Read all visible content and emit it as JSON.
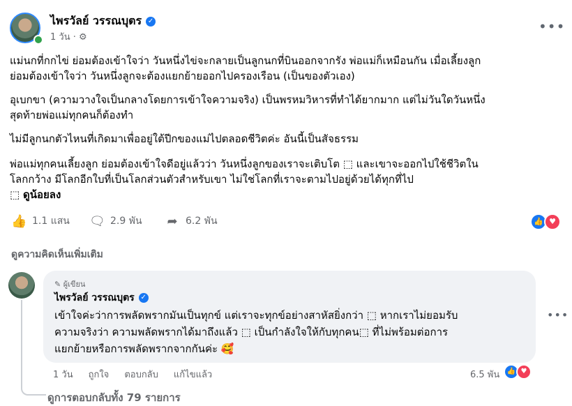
{
  "post": {
    "author": "ไพรวัลย์ วรรณบุตร",
    "time": "1 วัน",
    "paragraphs": [
      [
        "แม่นกที่กกไข่ ย่อมต้องเข้าใจว่า วันหนึ่งไข่จะกลายเป็นลูกนกที่บินออกจากรัง พ่อแม่ก็เหมือนกัน เมื่อเลี้ยงลูก",
        "ย่อมต้องเข้าใจว่า วันหนึ่งลูกจะต้องแยกย้ายออกไปครองเรือน (เป็นของตัวเอง)"
      ],
      [
        "อุเบกขา (ความวางใจเป็นกลางโดยการเข้าใจความจริง) เป็นพรหมวิหารที่ทำได้ยากมาก แต่ไม่วันใดวันหนึ่ง",
        "สุดท้ายพ่อแม่ทุกคนก็ต้องทำ"
      ],
      [
        "ไม่มีลูกนกตัวไหนที่เกิดมาเพื่ออยู่ใต้ปีกของแม่ไปตลอดชีวิตค่ะ อันนี้เป็นสัจธรรม"
      ],
      [
        "พ่อแม่ทุกคนเลี้ยงลูก ย่อมต้องเข้าใจดีอยู่แล้วว่า วันหนึ่งลูกของเราจะเติบโต ⬚ และเขาจะออกไปใช้ชีวิตใน",
        "โลกกว้าง มีโลกอีกใบที่เป็นโลกส่วนตัวสำหรับเขา ไม่ใช่โลกที่เราจะตามไปอยู่ด้วยได้ทุกที่ไป"
      ]
    ],
    "last_line_glyph": "⬚",
    "see_less": "ดูน้อยลง",
    "likes": "1.1 แสน",
    "comments": "2.9 พัน",
    "shares": "6.2 พัน"
  },
  "comments_section": {
    "view_more": "ดูความคิดเห็นเพิ่มเติม",
    "comment": {
      "badge": "ผู้เขียน",
      "author": "ไพรวัลย์ วรรณบุตร",
      "lines": [
        "เข้าใจค่ะว่าการพลัดพรากมันเป็นทุกข์ แต่เราจะทุกข์อย่างสาหัสยิ่งกว่า ⬚ หากเราไม่ยอมรับ",
        "ความจริงว่า ความพลัดพรากได้มาถึงแล้ว ⬚ เป็นกำลังใจให้กับทุกคน⬚ ที่ไม่พร้อมต่อการ",
        "แยกย้ายหรือการพลัดพรากจากกันค่ะ 🥰"
      ],
      "time": "1 วัน",
      "like": "ถูกใจ",
      "reply": "ตอบกลับ",
      "edited": "แก้ไขแล้ว",
      "reactions": "6.5 พัน"
    },
    "all_replies": "ดูการตอบกลับทั้ง 79 รายการ"
  },
  "colors": {
    "accent": "#1877f2",
    "love": "#f33e58",
    "muted": "#65676b"
  }
}
